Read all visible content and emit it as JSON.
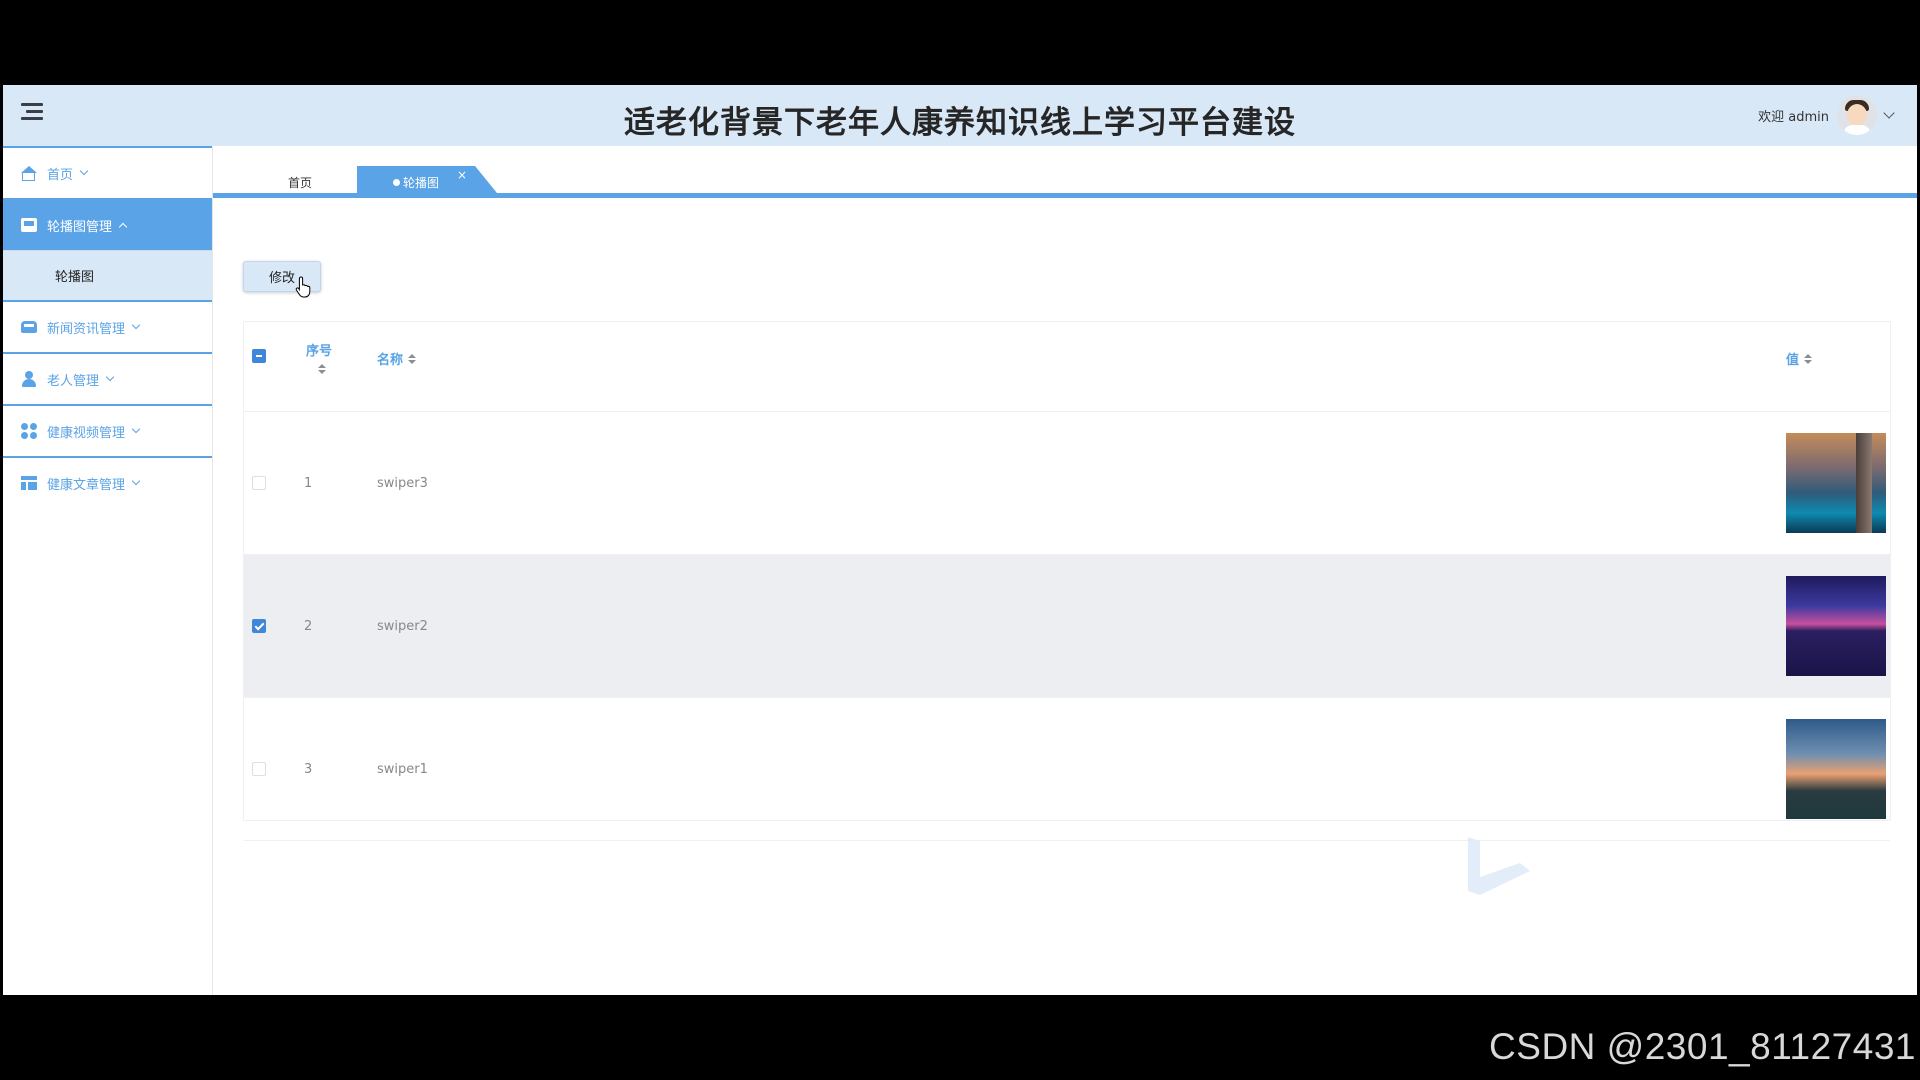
{
  "header": {
    "title": "适老化背景下老年人康养知识线上学习平台建设",
    "welcome": "欢迎 admin"
  },
  "sidebar": {
    "items": [
      {
        "label": "首页",
        "icon": "home-icon",
        "expanded": false
      },
      {
        "label": "轮播图管理",
        "icon": "picture-icon",
        "expanded": true
      },
      {
        "label": "新闻资讯管理",
        "icon": "bus-icon",
        "expanded": false
      },
      {
        "label": "老人管理",
        "icon": "user-icon",
        "expanded": false
      },
      {
        "label": "健康视频管理",
        "icon": "grid-icon",
        "expanded": false
      },
      {
        "label": "健康文章管理",
        "icon": "table-icon",
        "expanded": false
      }
    ],
    "submenu": {
      "label": "轮播图"
    }
  },
  "tabs": {
    "home": "首页",
    "active": "轮播图",
    "close": "×"
  },
  "toolbar": {
    "edit_label": "修改"
  },
  "table": {
    "columns": {
      "index": "序号",
      "name": "名称",
      "value": "值"
    },
    "rows": [
      {
        "index": "1",
        "name": "swiper3",
        "checked": false
      },
      {
        "index": "2",
        "name": "swiper2",
        "checked": true
      },
      {
        "index": "3",
        "name": "swiper1",
        "checked": false
      }
    ]
  },
  "watermark": "CSDN @2301_81127431",
  "colors": {
    "accent": "#5aa3e6",
    "header_bg": "#d9e8f7",
    "checkbox": "#3f87d9"
  }
}
